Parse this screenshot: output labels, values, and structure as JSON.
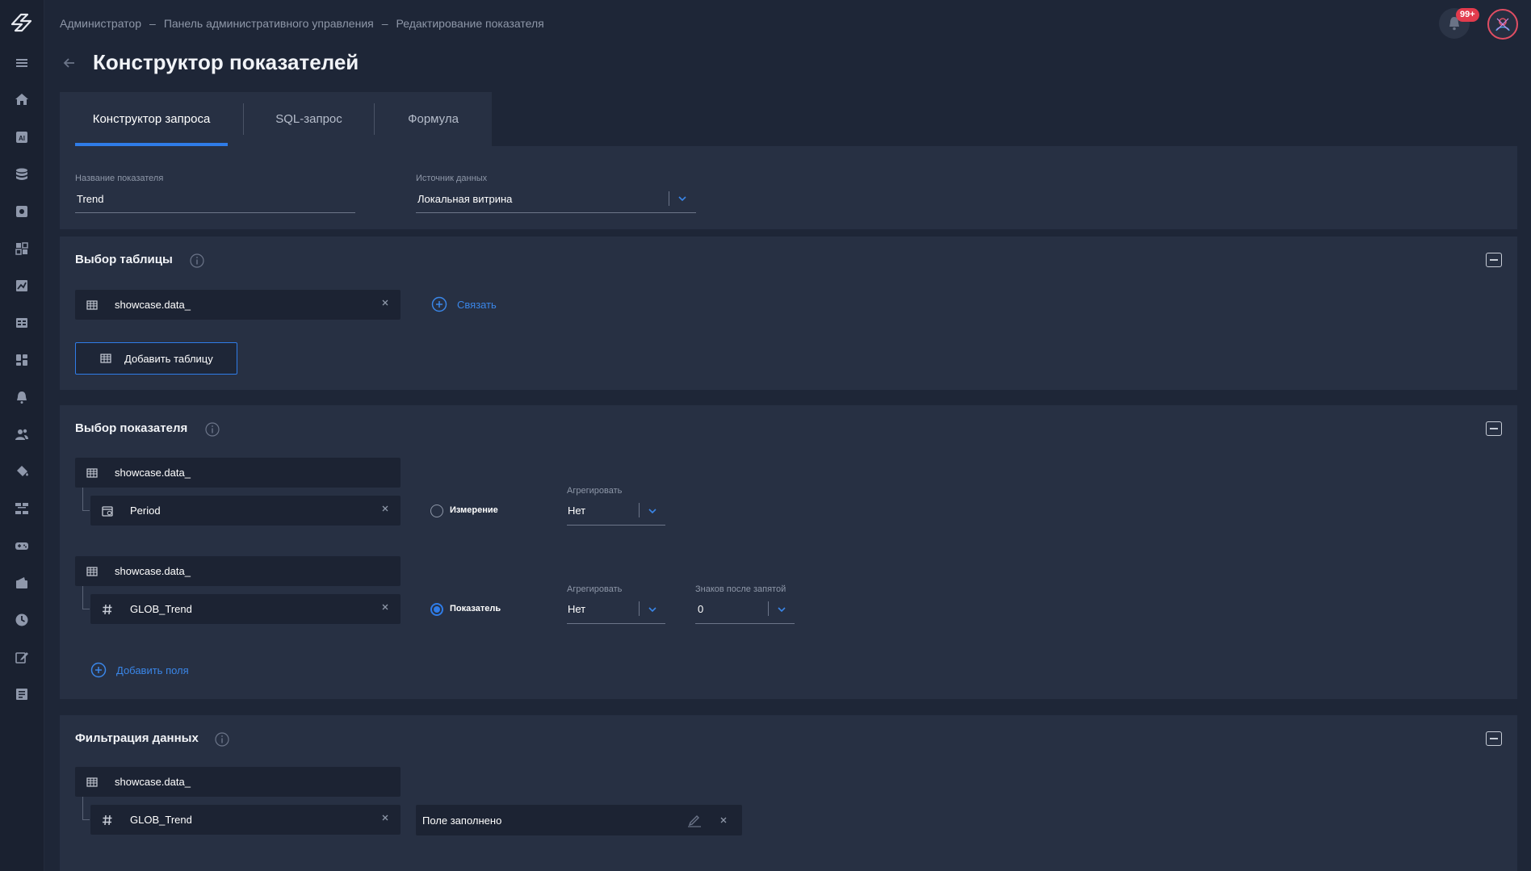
{
  "breadcrumb": {
    "items": [
      "Администратор",
      "Панель административного управления",
      "Редактирование показателя"
    ],
    "separator": "–"
  },
  "notifications": {
    "badge": "99+"
  },
  "page": {
    "title": "Конструктор показателей"
  },
  "tabs": [
    "Конструктор запроса",
    "SQL-запрос",
    "Формула"
  ],
  "form": {
    "name_label": "Название показателя",
    "name_value": "Trend",
    "source_label": "Источник данных",
    "source_value": "Локальная витрина"
  },
  "table_section": {
    "title": "Выбор таблицы",
    "table_chip": "showcase.data_",
    "link_label": "Связать",
    "add_table_label": "Добавить таблицу"
  },
  "indicator_section": {
    "title": "Выбор показателя",
    "rows": [
      {
        "table": "showcase.data_",
        "field": "Period",
        "field_icon": "calendar-icon",
        "radio_label": "Измерение",
        "radio_checked": false,
        "aggregate_label": "Агрегировать",
        "aggregate_value": "Нет"
      },
      {
        "table": "showcase.data_",
        "field": "GLOB_Trend",
        "field_icon": "hash-icon",
        "radio_label": "Показатель",
        "radio_checked": true,
        "aggregate_label": "Агрегировать",
        "aggregate_value": "Нет",
        "decimals_label": "Знаков после запятой",
        "decimals_value": "0"
      }
    ],
    "add_fields_label": "Добавить поля"
  },
  "filter_section": {
    "title": "Фильтрация данных",
    "table": "showcase.data_",
    "field": "GLOB_Trend",
    "condition": "Поле заполнено"
  },
  "colors": {
    "background": "#1e2637",
    "panel": "#273043",
    "accent": "#2f7ce8",
    "badge": "#e23b4d"
  }
}
